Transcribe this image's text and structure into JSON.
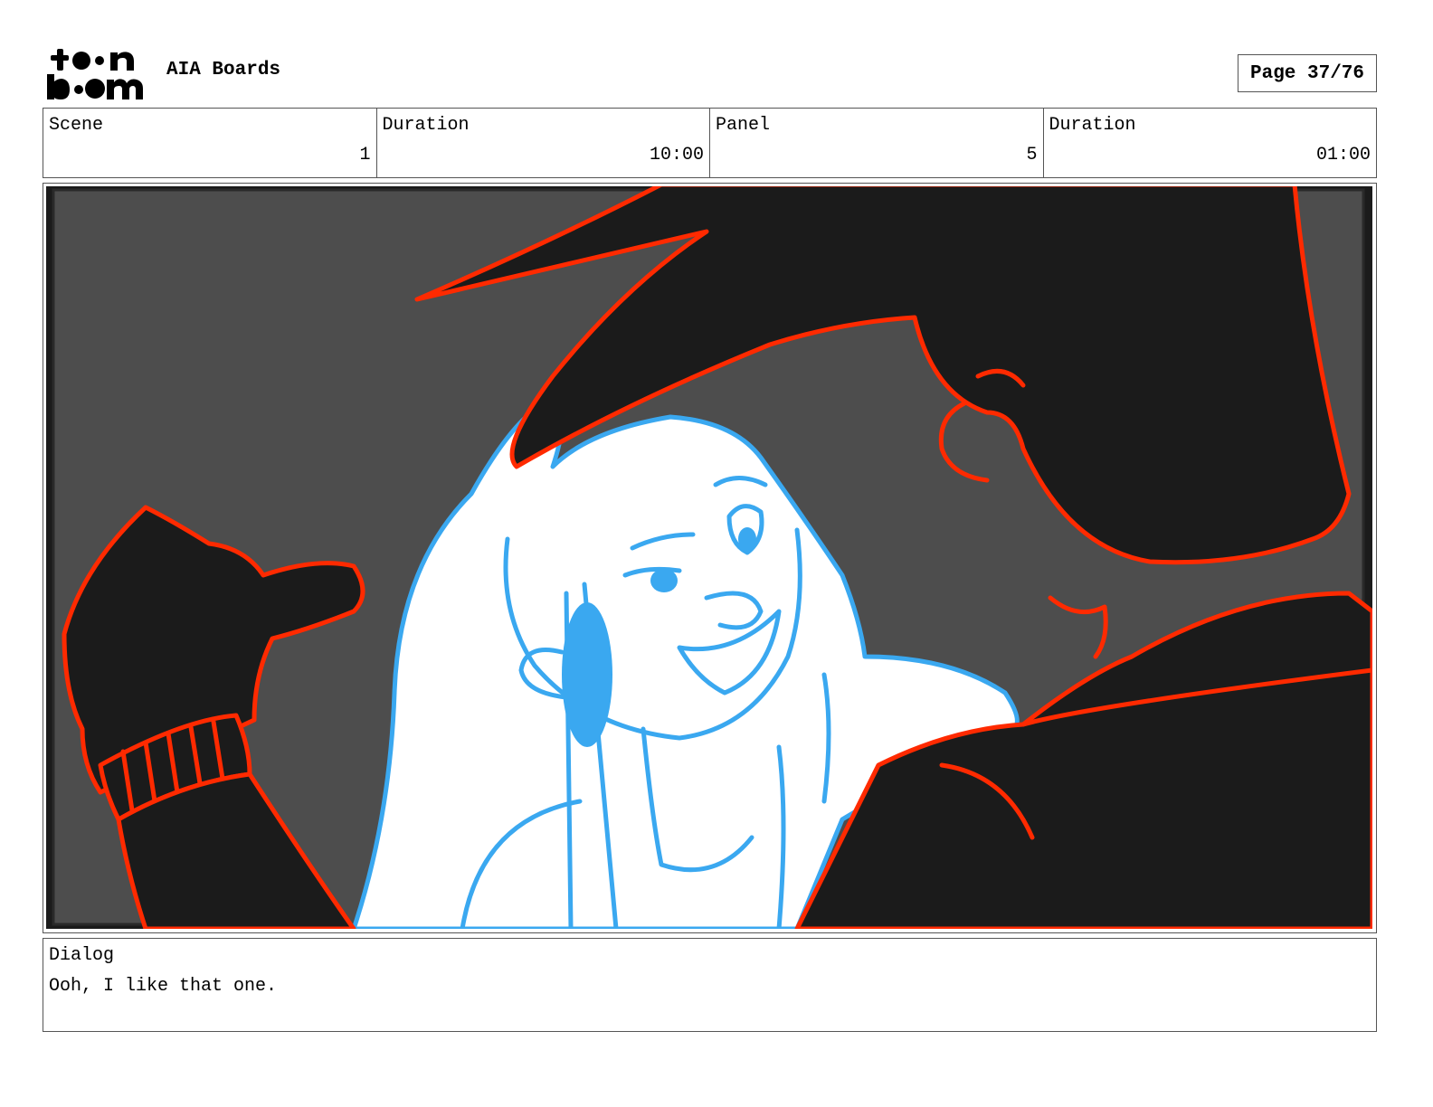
{
  "header": {
    "logo_text": "toon boom",
    "project_title": "AIA Boards",
    "page_label": "Page 37/76"
  },
  "info": {
    "scene_label": "Scene",
    "scene_value": "1",
    "scene_duration_label": "Duration",
    "scene_duration_value": "10:00",
    "panel_label": "Panel",
    "panel_value": "5",
    "panel_duration_label": "Duration",
    "panel_duration_value": "01:00"
  },
  "dialog": {
    "label": "Dialog",
    "text": "Ooh, I like that one."
  },
  "colors": {
    "background_grey": "#4d4d4d",
    "silhouette": "#1b1b1b",
    "red_line": "#ff2a00",
    "blue_line": "#3aa8f0"
  }
}
